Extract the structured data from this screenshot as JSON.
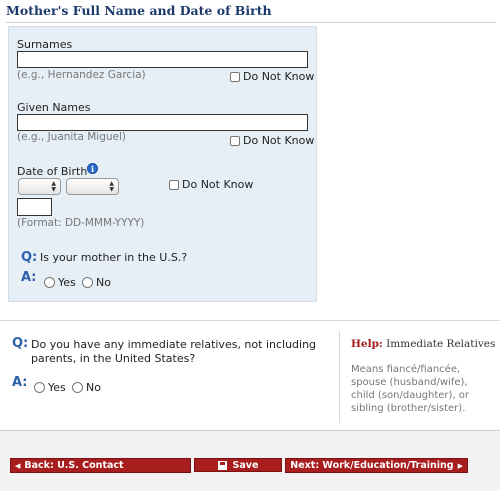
{
  "section_title": "Mother's Full Name and Date of Birth",
  "surnames": {
    "label": "Surnames",
    "value": "",
    "example": "(e.g., Hernandez Garcia)",
    "do_not_know": "Do Not Know"
  },
  "given_names": {
    "label": "Given Names",
    "value": "",
    "example": "(e.g., Juanita Miguel)",
    "do_not_know": "Do Not Know"
  },
  "dob": {
    "label": "Date of Birth",
    "info_icon": "info-icon",
    "day_select": "",
    "month_select": "",
    "year_value": "",
    "format": "(Format: DD-MMM-YYYY)",
    "do_not_know": "Do Not Know"
  },
  "q_mother": {
    "q_mark": "Q:",
    "question": "Is your mother in the U.S.?",
    "a_mark": "A:",
    "yes": "Yes",
    "no": "No"
  },
  "q_relatives": {
    "q_mark": "Q:",
    "question_line1": "Do you have any immediate relatives, not including",
    "question_line2": "parents, in the United States?",
    "a_mark": "A:",
    "yes": "Yes",
    "no": "No"
  },
  "help": {
    "word": "Help:",
    "topic": "Immediate Relatives",
    "text": "Means fiancé/fiancée, spouse (husband/wife), child (son/daughter), or sibling (brother/sister)."
  },
  "footer": {
    "back_label": "Back: U.S. Contact",
    "save_label": "Save",
    "next_label": "Next: Work/Education/Training"
  },
  "colors": {
    "panel_bg": "#e6eef6",
    "title_blue": "#1b3a6b",
    "button_red": "#a81d1d",
    "help_red": "#a31a1a"
  }
}
